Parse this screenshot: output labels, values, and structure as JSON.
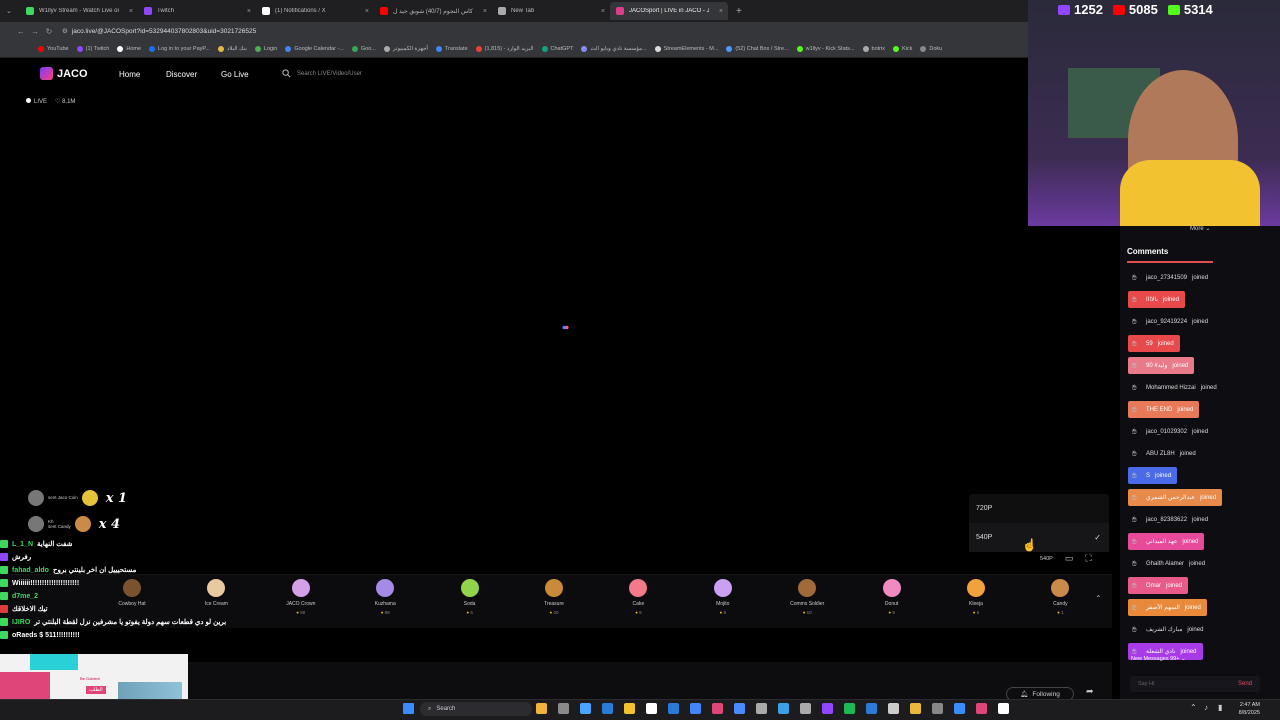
{
  "browser": {
    "tabs": [
      {
        "title": "W1llyv Stream - Watch Live on",
        "color": "#3fd95f"
      },
      {
        "title": "Twitch",
        "color": "#9146ff"
      },
      {
        "title": "(1) Notifications / X",
        "color": "#ffffff"
      },
      {
        "title": "كأس النجوم (40/7) شوبق جيد ل...",
        "color": "#ff0000"
      },
      {
        "title": "New Tab",
        "color": "#aaaaaa"
      },
      {
        "title": "JACOSport | LIVE in JACO - JACO",
        "color": "#e03c8c"
      }
    ],
    "url": "jaco.live/@JACOSport?id=532944037802803&uid=3021726525",
    "bookmarks": [
      "YouTube",
      "(1) Twitch",
      "Home",
      "Log in to your PayP...",
      "بنك البلاد",
      "Login",
      "Google Calendar -...",
      "Goo...",
      "أجهزة الكمبيوتر",
      "Translate",
      "(1,815) - البريد الوارد",
      "ChatGPT",
      "مؤسسة نادي وبايو الث...",
      "StreamElements - M...",
      "(52) Chat Box / Stre...",
      "w1llyv - Kick Stats...",
      "botrix",
      "Kick",
      "Doku"
    ]
  },
  "site": {
    "logo": "JACO",
    "nav": [
      "Home",
      "Discover",
      "Go Live"
    ],
    "search_placeholder": "Search LIVE/Video/User",
    "live_label": "LIVE",
    "likes": "8.1M"
  },
  "player": {
    "quality_options": [
      "720P",
      "540P"
    ],
    "selected_quality": "540P",
    "quality_badge": "540P"
  },
  "gifts": [
    {
      "name": "Cowboy Hat",
      "price": "",
      "color": "#7a5230"
    },
    {
      "name": "Ice Cream",
      "price": "",
      "color": "#e8c9a0"
    },
    {
      "name": "JACO Crown",
      "price": "50",
      "color": "#d4a0e8"
    },
    {
      "name": "Kuzhama",
      "price": "99",
      "color": "#a58be8"
    },
    {
      "name": "Soda",
      "price": "6",
      "color": "#8fd44a"
    },
    {
      "name": "Treasure",
      "price": "20",
      "color": "#c98a3a"
    },
    {
      "name": "Cake",
      "price": "9",
      "color": "#f27a8a"
    },
    {
      "name": "Mojito",
      "price": "9",
      "color": "#c9a0f2"
    },
    {
      "name": "Comms Soldier",
      "price": "10",
      "color": "#a06a3a"
    },
    {
      "name": "Donut",
      "price": "9",
      "color": "#f28ac2"
    },
    {
      "name": "Kleeja",
      "price": "6",
      "color": "#f2a23a"
    },
    {
      "name": "Candy",
      "price": "1",
      "color": "#c98a4a"
    }
  ],
  "gift_alerts": [
    {
      "sender": "",
      "action": "sent Jaco Coin",
      "count": "x 1",
      "color": "#e6c23a"
    },
    {
      "sender": "Kh",
      "action": "sent Candy",
      "count": "x 4",
      "color": "#c98a4a"
    }
  ],
  "stream_chat": [
    {
      "user": "L_1_N",
      "message": "شفت النهاية",
      "platform": "#3fd95f"
    },
    {
      "user": "",
      "message": "رفرش",
      "platform": "#9146ff"
    },
    {
      "user": "fahad_aldo",
      "message": "مستحيييل ان اخر بلينتي بروح",
      "platform": "#3fd95f"
    },
    {
      "user": "",
      "message": "Wiiiiii!!!!!!!!!!!!!!!!!!!!!",
      "platform": "#3fd95f"
    },
    {
      "user": "d7me_2",
      "message": "",
      "platform": "#3fd95f"
    },
    {
      "user": "",
      "message": "تيك الاخلاقك",
      "platform": "#e03c3c"
    },
    {
      "user": "IJIRO",
      "message": "برين لو دي قطعات سهم دولة يفوتو يا مشرفين نزل لقطة البلنتي تر",
      "platform": "#3fd95f"
    },
    {
      "user": "",
      "message": "oRaeds $ 511!!!!!!!!!!",
      "platform": "#3fd95f"
    }
  ],
  "promo": {
    "tag": "الطلب",
    "subtitle": "Be Golden!"
  },
  "streamer_stats": {
    "twitch": "1252",
    "youtube": "5085",
    "kick": "5314"
  },
  "comments_panel": {
    "more_label": "More",
    "title": "Comments",
    "items": [
      {
        "user": "jaco_27341509",
        "action": "joined",
        "highlight": ""
      },
      {
        "user": "بالاااا",
        "action": "joined",
        "highlight": "#e8494a"
      },
      {
        "user": "jaco_92419224",
        "action": "joined",
        "highlight": ""
      },
      {
        "user": "59",
        "action": "joined",
        "highlight": "#e8494a"
      },
      {
        "user": "90 #وليد",
        "action": "joined",
        "highlight": "#e87a8a"
      },
      {
        "user": "Mohammed Hizzai",
        "action": "joined",
        "highlight": ""
      },
      {
        "user": "THE END",
        "action": "joined",
        "highlight": "#e87a5a"
      },
      {
        "user": "jaco_01029302",
        "action": "joined",
        "highlight": ""
      },
      {
        "user": "ABU ZL8H",
        "action": "joined",
        "highlight": ""
      },
      {
        "user": "S",
        "action": "joined",
        "highlight": "#4a6ae8"
      },
      {
        "user": "عبدالرحمن الشمري",
        "action": "joined",
        "highlight": "#e88a4a"
      },
      {
        "user": "jaco_82383622",
        "action": "joined",
        "highlight": ""
      },
      {
        "user": "عهد الميداني",
        "action": "joined",
        "highlight": "#e84a9a"
      },
      {
        "user": "Ghaith Alamer",
        "action": "joined",
        "highlight": ""
      },
      {
        "user": "Omar",
        "action": "joined",
        "highlight": "#e85a8a"
      },
      {
        "user": "السهم الأصفر",
        "action": "joined",
        "highlight": "#e88a3a"
      },
      {
        "user": "مبارك الشريف",
        "action": "joined",
        "highlight": ""
      },
      {
        "user": "نادي الشعلة",
        "action": "joined",
        "highlight": "#a83ae8"
      }
    ],
    "new_messages": "New Messages 99+",
    "input_placeholder": "Say Hi",
    "send_label": "Send"
  },
  "player_controls": {
    "following_label": "Following"
  },
  "taskbar": {
    "search_label": "Search",
    "time": "2:47 AM",
    "date": "8/8/2025"
  }
}
